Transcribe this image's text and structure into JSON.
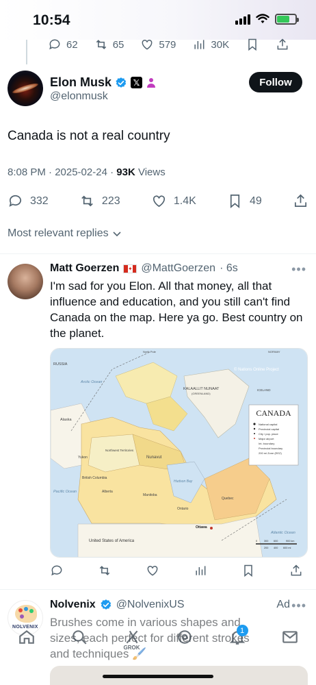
{
  "status_bar": {
    "time": "10:54"
  },
  "top_tweet_actions": {
    "replies": "62",
    "reposts": "65",
    "likes": "579",
    "views": "30K"
  },
  "tweet": {
    "display_name": "Elon Musk",
    "handle": "@elonmusk",
    "follow_label": "Follow",
    "text": "Canada is not a real country",
    "timestamp": "8:08 PM · 2025-02-24 · ",
    "views_count": "93K",
    "views_label": " Views",
    "replies": "332",
    "reposts": "223",
    "likes": "1.4K",
    "bookmarks": "49"
  },
  "sort_label": "Most relevant replies",
  "reply": {
    "display_name": "Matt Goerzen",
    "handle": "@MattGoerzen",
    "time": "· 6s",
    "text": "I'm sad for you Elon. All that money, all that influence and education, and you still can't find Canada on the map. Here ya go. Best country on the planet.",
    "map": {
      "title": "CANADA",
      "credit": "© Nations Online Project",
      "legend": [
        "National capital",
        "Provincial capital",
        "City / pop. place",
        "Major airport",
        "Int. boundary",
        "Provincial boundary",
        "200 mi Zone (EEZ)"
      ],
      "labels": {
        "russia": "RUSSIA",
        "greenland": "KALAALLIT NUNAAT",
        "greenland_sub": "(GREENLAND)",
        "iceland": "ICELAND",
        "usa": "United States of America",
        "alaska": "Alaska",
        "arctic": "Arctic Ocean",
        "pacific": "Pacific Ocean",
        "atlantic": "Atlantic Ocean",
        "hudson": "Hudson Bay",
        "north_pole": "North Pole",
        "norway": "NORWAY",
        "nunavut": "Nunavut",
        "nwt": "Northwest Territories",
        "yukon": "Yukon",
        "bc": "British Columbia",
        "alberta": "Alberta",
        "manitoba": "Manitoba",
        "ontario": "Ontario",
        "quebec": "Quebec",
        "ottawa": "Ottawa"
      },
      "scale": [
        "0",
        "300",
        "600",
        "900 km",
        "200",
        "400",
        "600 mi"
      ]
    }
  },
  "ad": {
    "display_name": "Nolvenix",
    "handle": "@NolvenixUS",
    "tag": "Ad",
    "brand_text": "NOLVENIX",
    "text": "Brushes come in various shapes and sizes, each perfect for different strokes and techniques 🖌️"
  },
  "bottom_nav": {
    "grok_label": "GROK",
    "notifications_badge": "1"
  },
  "colors": {
    "accent": "#1d9bf0",
    "follow_bg": "#0f1419",
    "muted": "#536471"
  }
}
